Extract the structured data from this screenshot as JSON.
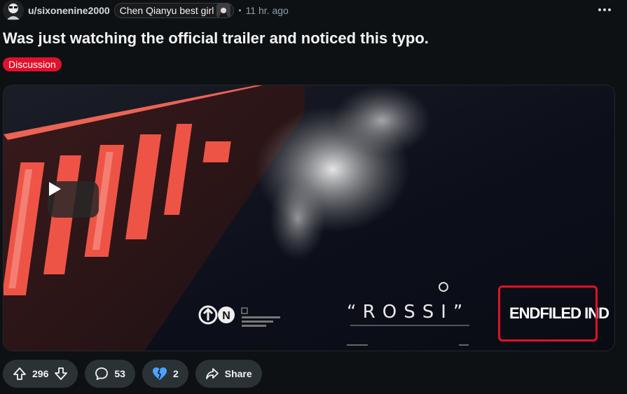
{
  "post": {
    "username": "u/sixonenine2000",
    "flair": "Chen Qianyu best girl",
    "separator": "•",
    "time": "11 hr. ago",
    "title": "Was just watching the official trailer and noticed this typo.",
    "tag": "Discussion"
  },
  "media": {
    "big_text": "ROSSI",
    "quoted_text": "“ROSSI”",
    "highlighted_text": "ENDFILED IND",
    "colors": {
      "highlight_box": "#e0112b",
      "accent_red": "#e0112b"
    }
  },
  "actions": {
    "votes": "296",
    "comments": "53",
    "awards": "2",
    "share": "Share"
  },
  "icons": [
    "avatar",
    "flair-emoji",
    "more-icon",
    "play-icon",
    "upvote-icon",
    "downvote-icon",
    "comment-icon",
    "award-icon",
    "share-icon"
  ]
}
